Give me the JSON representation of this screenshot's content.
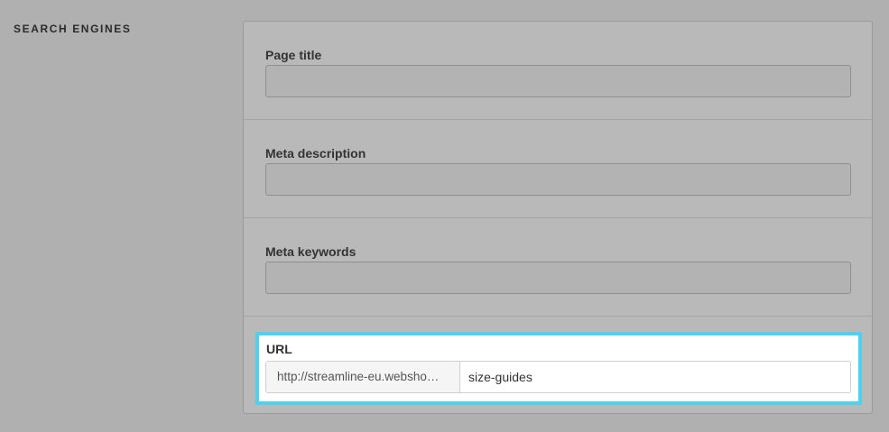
{
  "section": {
    "heading": "SEARCH ENGINES"
  },
  "fields": {
    "page_title": {
      "label": "Page title",
      "value": ""
    },
    "meta_description": {
      "label": "Meta description",
      "value": ""
    },
    "meta_keywords": {
      "label": "Meta keywords",
      "value": ""
    },
    "url": {
      "label": "URL",
      "prefix": "http://streamline-eu.websho…",
      "slug": "size-guides"
    }
  },
  "colors": {
    "highlight": "#4fd0ef",
    "overlay": "#b0b0b0"
  }
}
